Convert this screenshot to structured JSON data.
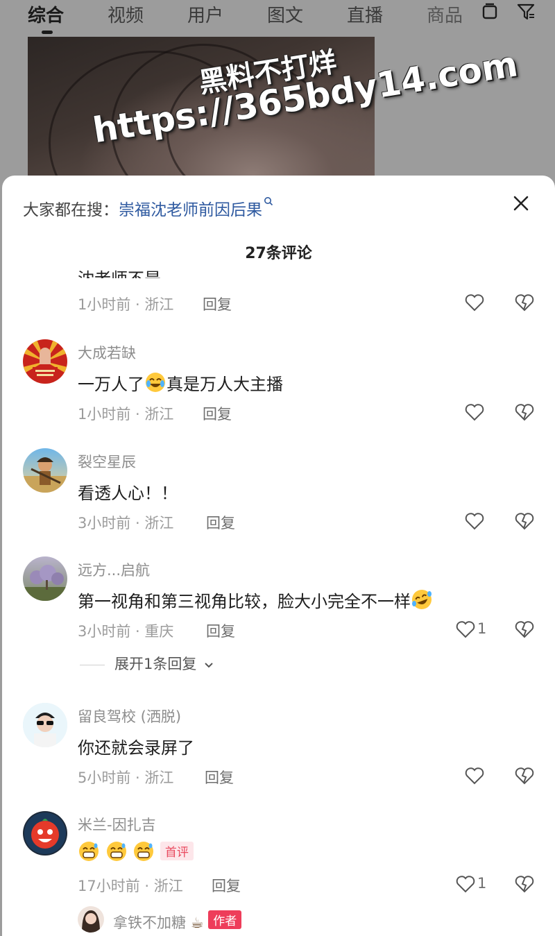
{
  "header": {
    "tabs": [
      "综合",
      "视频",
      "用户",
      "图文",
      "直播",
      "商品"
    ],
    "active_tab": "综合"
  },
  "watermark": {
    "line1": "黑料不打烊",
    "line2": "https://365bdy14.com"
  },
  "sheet": {
    "suggest_label": "大家都在搜：",
    "suggest_query": "崇福沈老师前因后果",
    "comment_count": "27条评论",
    "cut_text": "沈老师不是",
    "first_meta": "1小时前 · 浙江",
    "reply_label": "回复",
    "comments": [
      {
        "user": "大成若缺",
        "text_before": "一万人了",
        "text_after": "真是万人大主播",
        "meta": "1小时前 · 浙江",
        "likes": ""
      },
      {
        "user": "裂空星辰",
        "text": "看透人心！！",
        "meta": "3小时前 · 浙江",
        "likes": ""
      },
      {
        "user": "远方...启航",
        "text": "第一视角和第三视角比较，脸大小完全不一样",
        "meta": "3小时前 · 重庆",
        "likes": "1"
      },
      {
        "user": "留良驾校 (洒脱)",
        "text": "你还就会录屏了",
        "meta": "5小时前 · 浙江",
        "likes": ""
      },
      {
        "user": "米兰-因扎吉",
        "badge": "首评",
        "meta": "17小时前 · 浙江",
        "likes": "1"
      }
    ],
    "expand_label": "展开1条回复",
    "author_reply": {
      "user": "拿铁不加糖",
      "badge": "作者"
    }
  },
  "colors": {
    "link": "#2f5aa0",
    "badge_red": "#ee3d5a"
  }
}
